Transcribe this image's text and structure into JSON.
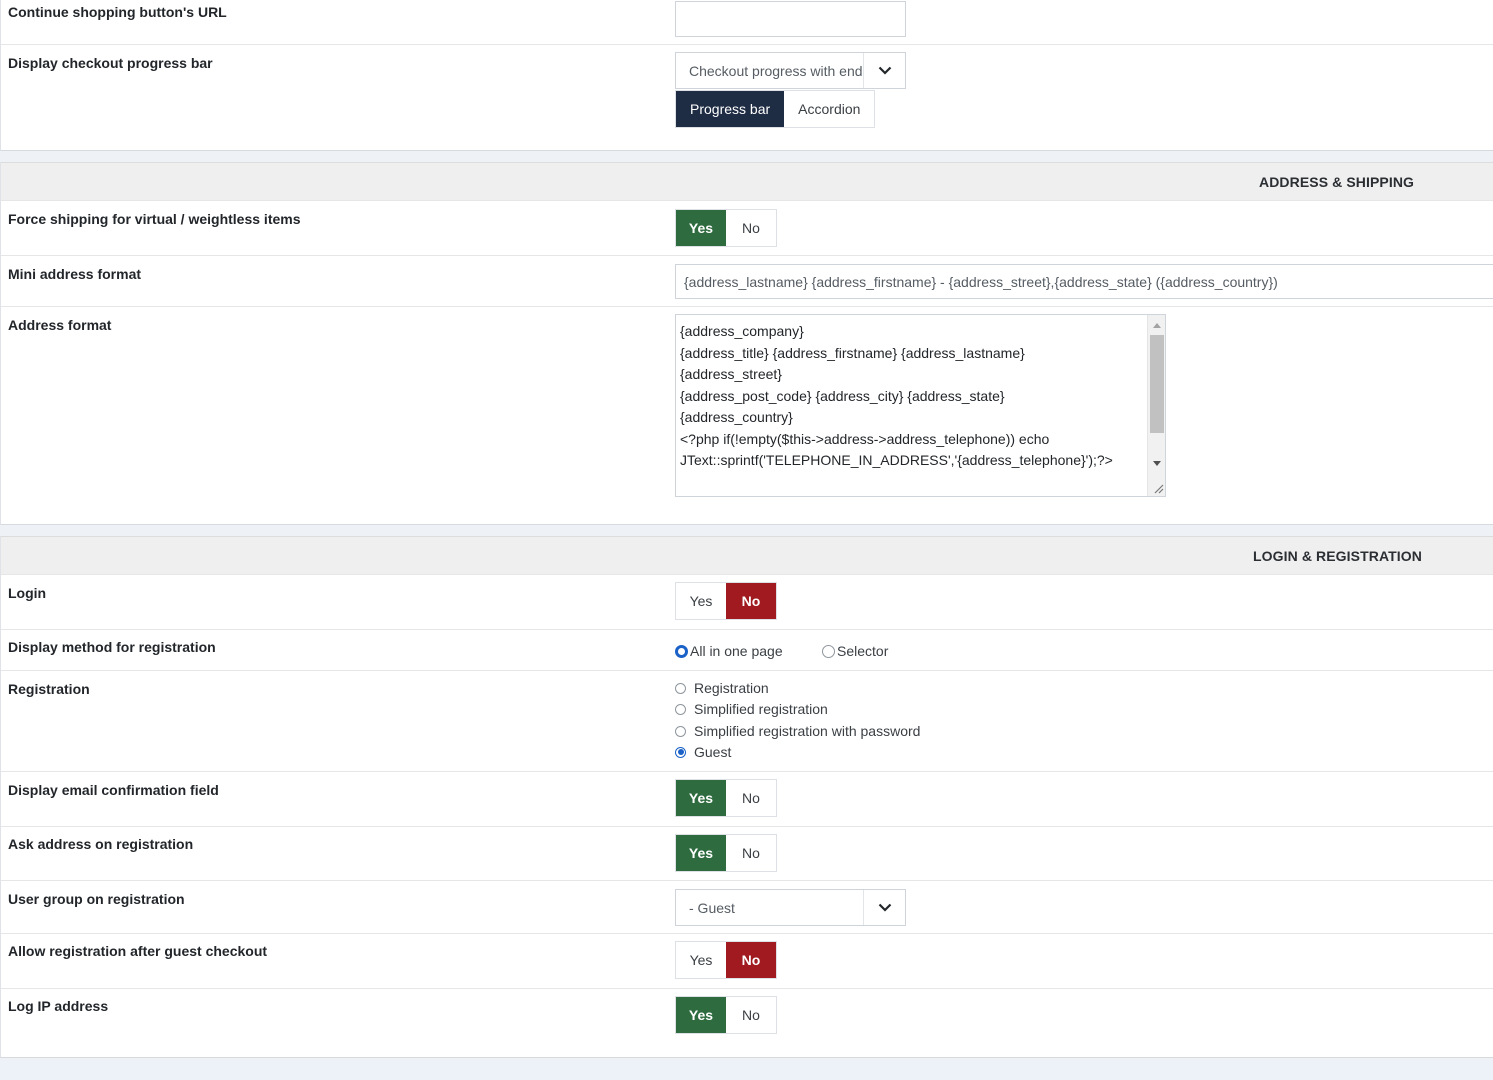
{
  "general": {
    "continue_url": {
      "label": "Continue shopping button's URL",
      "value": ""
    },
    "progress": {
      "label": "Display checkout progress bar",
      "select_value": "Checkout progress with end",
      "options": [
        "Progress bar",
        "Accordion"
      ],
      "selected": "Progress bar"
    }
  },
  "address_shipping": {
    "title": "ADDRESS & SHIPPING",
    "force_shipping": {
      "label": "Force shipping for virtual / weightless items",
      "yes": "Yes",
      "no": "No",
      "value": "Yes"
    },
    "mini_address": {
      "label": "Mini address format",
      "value": "{address_lastname} {address_firstname} - {address_street},{address_state} ({address_country})"
    },
    "address_format": {
      "label": "Address format",
      "lines": [
        "{address_company}",
        "{address_title} {address_firstname} {address_lastname}",
        "{address_street}",
        "{address_post_code} {address_city} {address_state}",
        "{address_country}",
        "<?php if(!empty($this->address->address_telephone)) echo",
        "JText::sprintf('TELEPHONE_IN_ADDRESS','{address_telephone}');?>"
      ]
    }
  },
  "login_registration": {
    "title": "LOGIN & REGISTRATION",
    "login": {
      "label": "Login",
      "yes": "Yes",
      "no": "No",
      "value": "No"
    },
    "display_method": {
      "label": "Display method for registration",
      "options": [
        "All in one page",
        "Selector"
      ],
      "selected": "All in one page"
    },
    "registration": {
      "label": "Registration",
      "options": [
        "Registration",
        "Simplified registration",
        "Simplified registration with password",
        "Guest"
      ],
      "selected": "Guest"
    },
    "email_confirm": {
      "label": "Display email confirmation field",
      "yes": "Yes",
      "no": "No",
      "value": "Yes"
    },
    "ask_address": {
      "label": "Ask address on registration",
      "yes": "Yes",
      "no": "No",
      "value": "Yes"
    },
    "user_group": {
      "label": "User group on registration",
      "value": "- Guest"
    },
    "allow_after_guest": {
      "label": "Allow registration after guest checkout",
      "yes": "Yes",
      "no": "No",
      "value": "No"
    },
    "log_ip": {
      "label": "Log IP address",
      "yes": "Yes",
      "no": "No",
      "value": "Yes"
    }
  },
  "icons": {
    "dropdown": "chevron-down-icon",
    "scroll_up": "arrow-up-icon",
    "scroll_down": "arrow-down-icon",
    "resize": "resize-grip-icon"
  },
  "colors": {
    "yes_active": "#2e6b3f",
    "no_active": "#a01a1f",
    "progress_active": "#1f2d44",
    "radio_active": "#1a62c7"
  }
}
